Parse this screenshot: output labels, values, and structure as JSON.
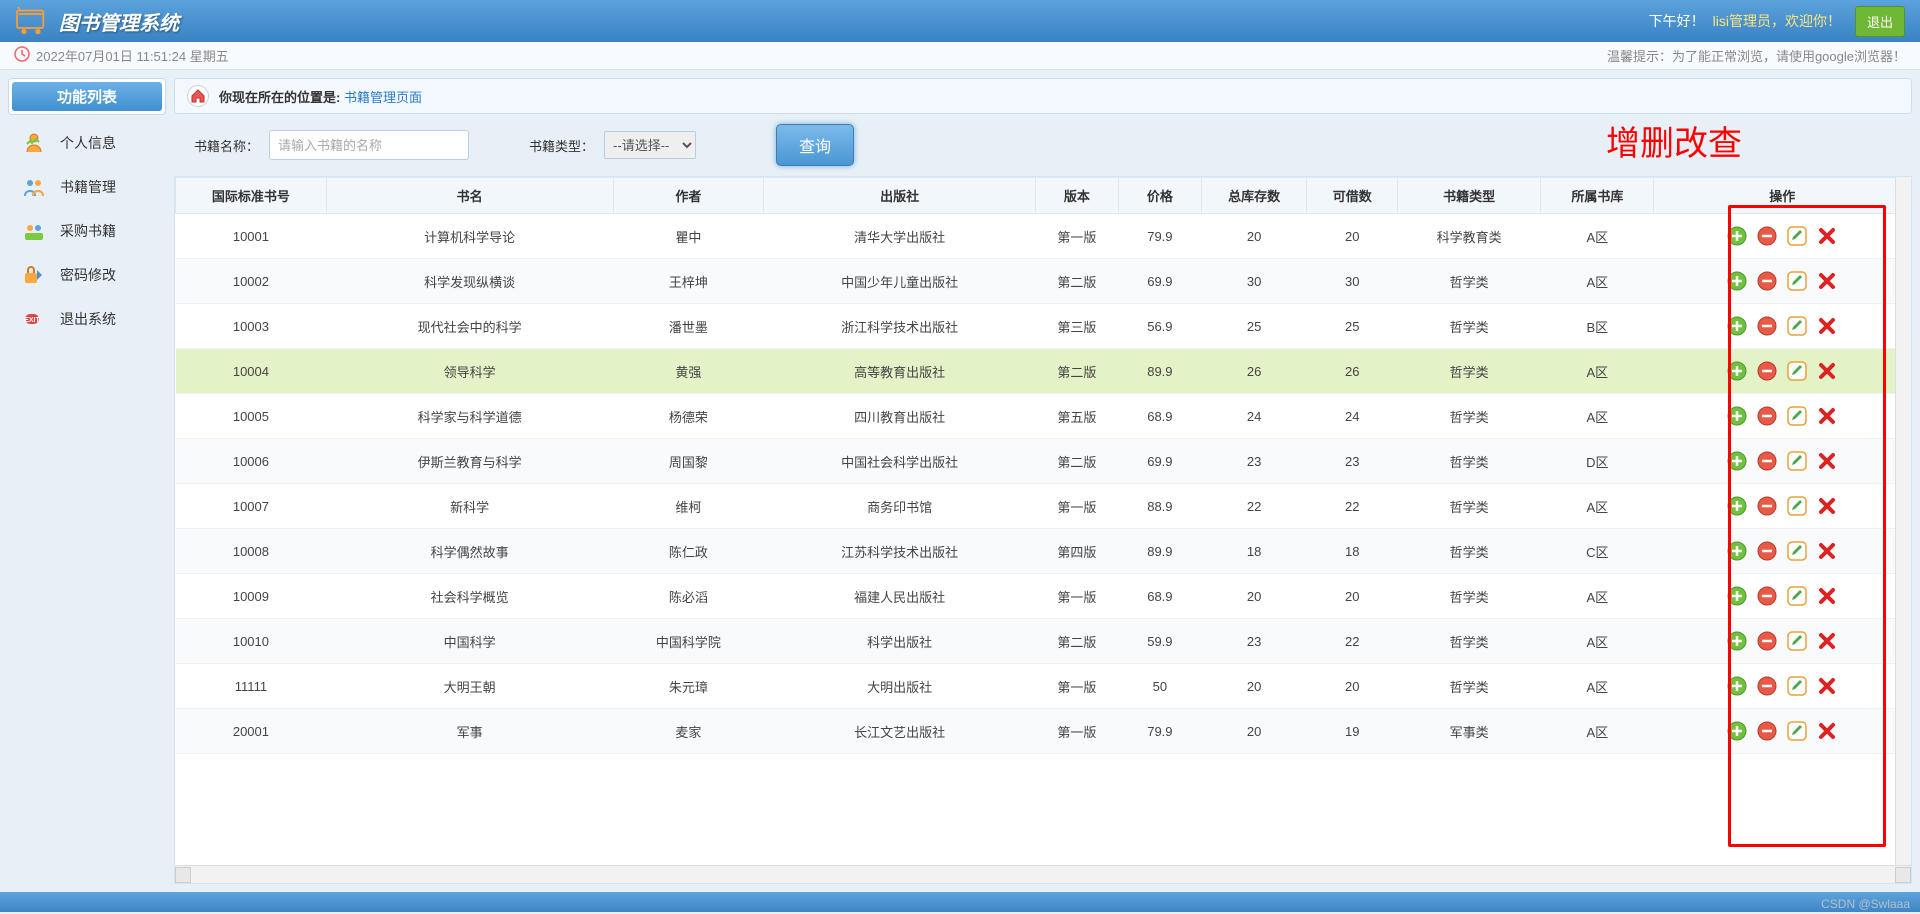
{
  "header": {
    "title": "图书管理系统",
    "greet": "下午好！",
    "user": "lisi管理员，欢迎你！",
    "logout": "退出"
  },
  "subbar": {
    "datetime": "2022年07月01日 11:51:24 星期五",
    "tip": "温馨提示：为了能正常浏览，请使用google浏览器！"
  },
  "sidebar": {
    "title": "功能列表",
    "items": [
      {
        "label": "个人信息"
      },
      {
        "label": "书籍管理"
      },
      {
        "label": "采购书籍"
      },
      {
        "label": "密码修改"
      },
      {
        "label": "退出系统"
      }
    ]
  },
  "breadcrumb": {
    "prefix": "你现在所在的位置是:",
    "link": "书籍管理页面"
  },
  "search": {
    "name_label": "书籍名称：",
    "name_ph": "请输入书籍的名称",
    "type_label": "书籍类型：",
    "select_ph": "--请选择--",
    "btn": "查询",
    "annotation": "增删改查"
  },
  "table": {
    "headers": [
      "国际标准书号",
      "书名",
      "作者",
      "出版社",
      "版本",
      "价格",
      "总库存数",
      "可借数",
      "书籍类型",
      "所属书库",
      "操作"
    ],
    "highlight_idx": 3,
    "rows": [
      [
        "10001",
        "计算机科学导论",
        "瞿中",
        "清华大学出版社",
        "第一版",
        "79.9",
        "20",
        "20",
        "科学教育类",
        "A区"
      ],
      [
        "10002",
        "科学发现纵横谈",
        "王梓坤",
        "中国少年儿童出版社",
        "第二版",
        "69.9",
        "30",
        "30",
        "哲学类",
        "A区"
      ],
      [
        "10003",
        "现代社会中的科学",
        "潘世墨",
        "浙江科学技术出版社",
        "第三版",
        "56.9",
        "25",
        "25",
        "哲学类",
        "B区"
      ],
      [
        "10004",
        "领导科学",
        "黄强",
        "高等教育出版社",
        "第二版",
        "89.9",
        "26",
        "26",
        "哲学类",
        "A区"
      ],
      [
        "10005",
        "科学家与科学道德",
        "杨德荣",
        "四川教育出版社",
        "第五版",
        "68.9",
        "24",
        "24",
        "哲学类",
        "A区"
      ],
      [
        "10006",
        "伊斯兰教育与科学",
        "周国黎",
        "中国社会科学出版社",
        "第二版",
        "69.9",
        "23",
        "23",
        "哲学类",
        "D区"
      ],
      [
        "10007",
        "新科学",
        "维柯",
        "商务印书馆",
        "第一版",
        "88.9",
        "22",
        "22",
        "哲学类",
        "A区"
      ],
      [
        "10008",
        "科学偶然故事",
        "陈仁政",
        "江苏科学技术出版社",
        "第四版",
        "89.9",
        "18",
        "18",
        "哲学类",
        "C区"
      ],
      [
        "10009",
        "社会科学概览",
        "陈必滔",
        "福建人民出版社",
        "第一版",
        "68.9",
        "20",
        "20",
        "哲学类",
        "A区"
      ],
      [
        "10010",
        "中国科学",
        "中国科学院",
        "科学出版社",
        "第二版",
        "59.9",
        "23",
        "22",
        "哲学类",
        "A区"
      ],
      [
        "11111",
        "大明王朝",
        "朱元璋",
        "大明出版社",
        "第一版",
        "50",
        "20",
        "20",
        "哲学类",
        "A区"
      ],
      [
        "20001",
        "军事",
        "麦家",
        "长江文艺出版社",
        "第一版",
        "79.9",
        "20",
        "19",
        "军事类",
        "A区"
      ]
    ]
  },
  "watermark": "CSDN @Swlaaa"
}
